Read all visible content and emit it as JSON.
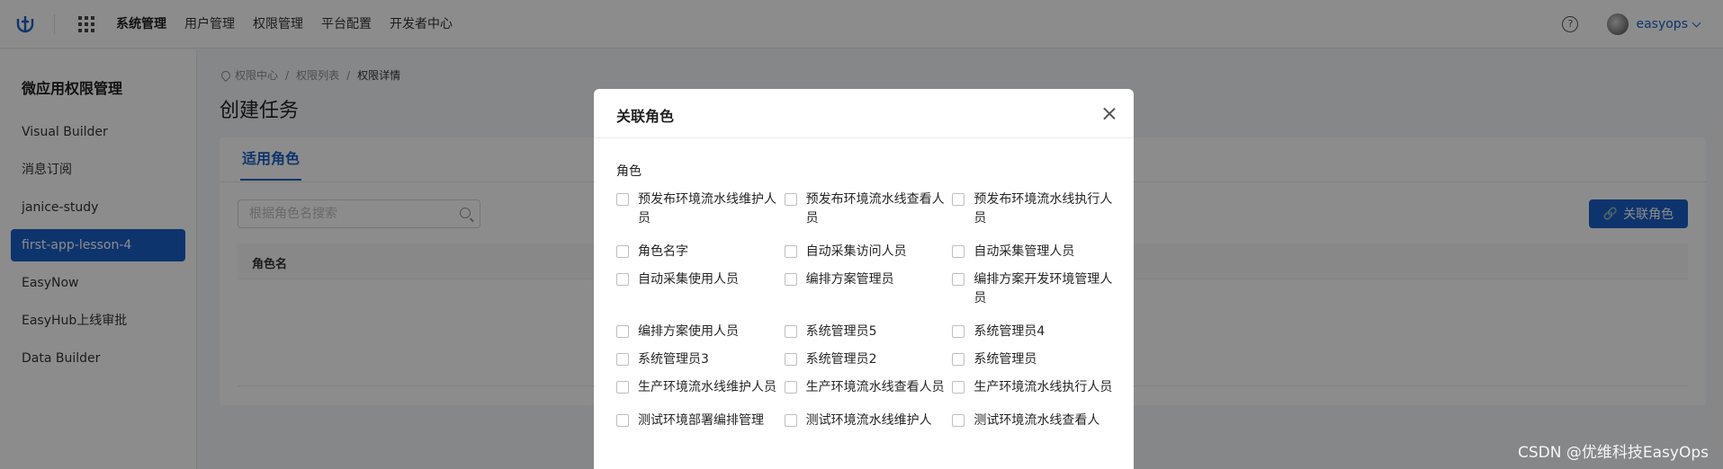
{
  "topbar": {
    "nav": [
      "系统管理",
      "用户管理",
      "权限管理",
      "平台配置",
      "开发者中心"
    ],
    "active_nav": 0,
    "help_glyph": "?",
    "user": "easyops"
  },
  "sidebar": {
    "title": "微应用权限管理",
    "items": [
      "Visual Builder",
      "消息订阅",
      "janice-study",
      "first-app-lesson-4",
      "EasyNow",
      "EasyHub上线审批",
      "Data Builder"
    ],
    "active": 3
  },
  "main": {
    "breadcrumb": [
      "权限中心",
      "权限列表",
      "权限详情"
    ],
    "title": "创建任务",
    "tab": "适用角色",
    "search_placeholder": "根据角色名搜索",
    "link_button": "关联角色",
    "column_header": "角色名"
  },
  "modal": {
    "title": "关联角色",
    "field_label": "角色",
    "options": [
      [
        "预发布环境流水线维护人员",
        "预发布环境流水线查看人员",
        "预发布环境流水线执行人员"
      ],
      [
        "角色名字",
        "自动采集访问人员",
        "自动采集管理人员"
      ],
      [
        "自动采集使用人员",
        "编排方案管理员",
        "编排方案开发环境管理人员"
      ],
      [
        "编排方案使用人员",
        "系统管理员5",
        "系统管理员4"
      ],
      [
        "系统管理员3",
        "系统管理员2",
        "系统管理员"
      ],
      [
        "生产环境流水线维护人员",
        "生产环境流水线查看人员",
        "生产环境流水线执行人员"
      ],
      [
        "测试环境部署编排管理",
        "测试环境流水线维护人",
        "测试环境流水线查看人"
      ]
    ]
  },
  "watermark": "CSDN @优维科技EasyOps",
  "colors": {
    "primary": "#1a5fc7",
    "mask": "rgba(0,0,0,0.45)"
  }
}
